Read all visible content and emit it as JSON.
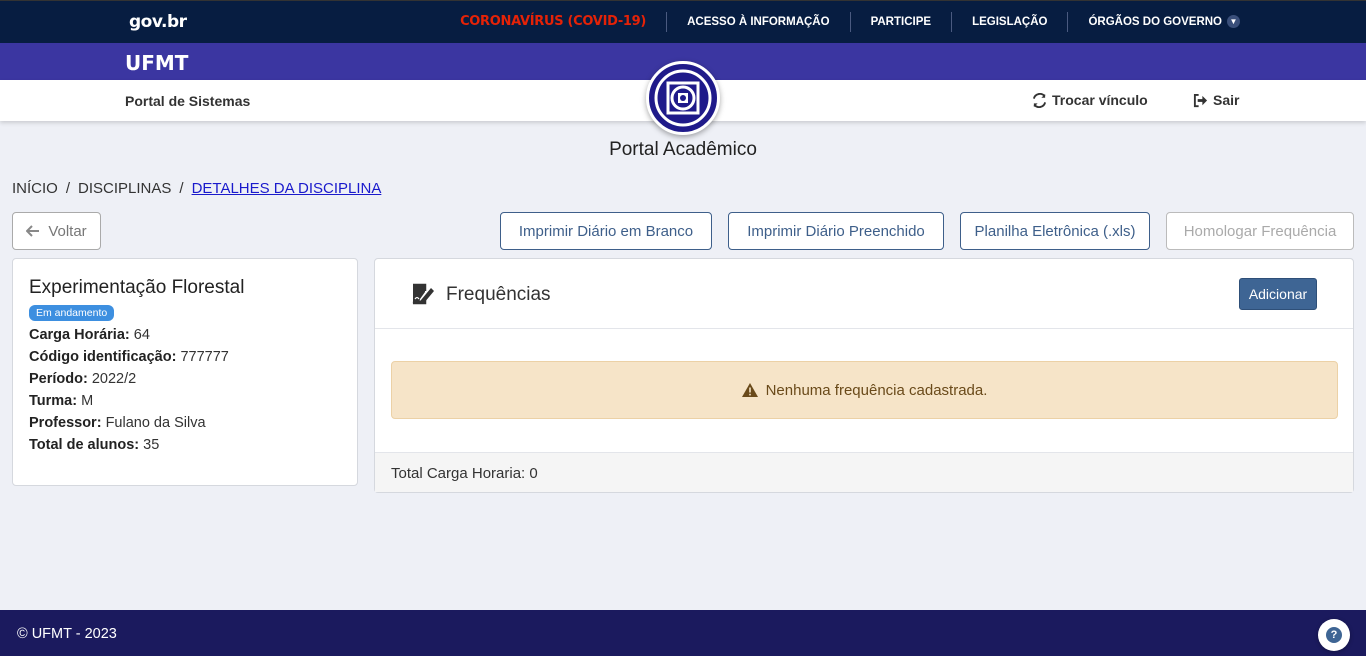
{
  "gov": {
    "logo": "gov.br",
    "links": [
      {
        "label": "CORONAVÍRUS (COVID-19)"
      },
      {
        "label": "ACESSO À INFORMAÇÃO"
      },
      {
        "label": "PARTICIPE"
      },
      {
        "label": "LEGISLAÇÃO"
      },
      {
        "label": "ÓRGÃOS DO GOVERNO"
      }
    ]
  },
  "header": {
    "brand": "UFMT",
    "portal_sistemas": "Portal de Sistemas",
    "trocar_vinculo": "Trocar vínculo",
    "sair": "Sair",
    "page_title": "Portal Acadêmico"
  },
  "breadcrumb": {
    "items": [
      "INÍCIO",
      "DISCIPLINAS",
      "DETALHES DA DISCIPLINA"
    ]
  },
  "toolbar": {
    "back": "Voltar",
    "print_blank": "Imprimir Diário em Branco",
    "print_filled": "Imprimir Diário Preenchido",
    "spreadsheet": "Planilha Eletrônica (.xls)",
    "homologate": "Homologar Frequência"
  },
  "course": {
    "title": "Experimentação Florestal",
    "status": "Em andamento",
    "fields": [
      {
        "label": "Carga Horária:",
        "value": "64"
      },
      {
        "label": "Código identificação:",
        "value": "777777"
      },
      {
        "label": "Período:",
        "value": "2022/2"
      },
      {
        "label": "Turma:",
        "value": "M"
      },
      {
        "label": "Professor:",
        "value": "Fulano da Silva"
      },
      {
        "label": "Total de alunos:",
        "value": "35"
      }
    ]
  },
  "frequencias": {
    "title": "Frequências",
    "add_button": "Adicionar",
    "empty_message": "Nenhuma frequência cadastrada.",
    "footer": "Total Carga Horaria: 0"
  },
  "footer": {
    "copyright": "© UFMT - 2023",
    "help": "?"
  },
  "colors": {
    "gov_bar": "#071d41",
    "brand_bar": "#3b36a1",
    "footer_bar": "#1b1a5e",
    "primary": "#3e6594",
    "covid": "#e52207"
  }
}
